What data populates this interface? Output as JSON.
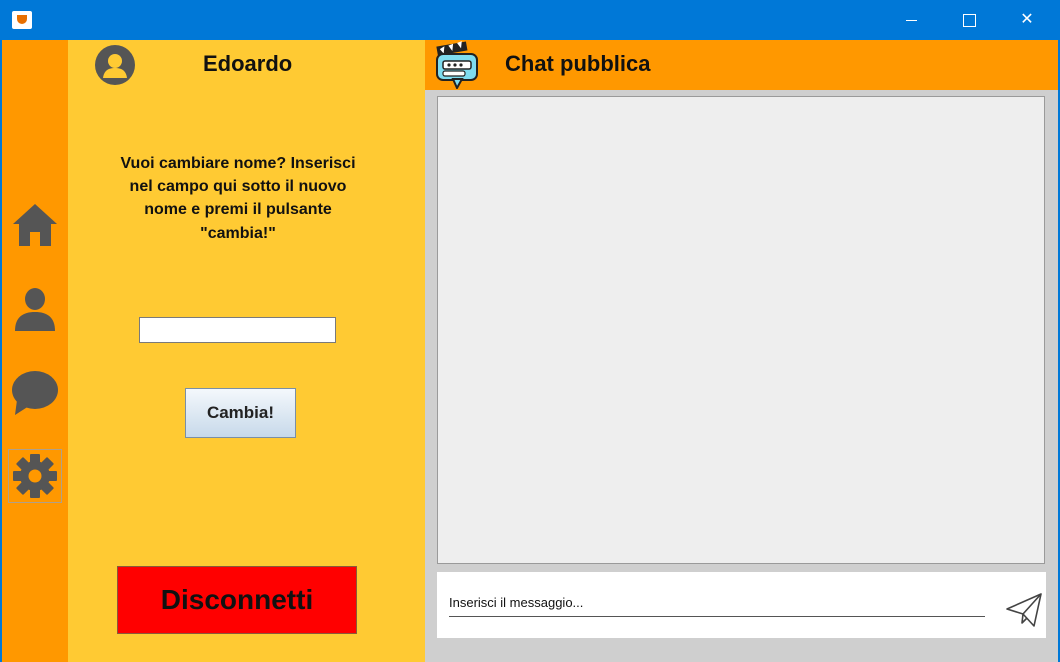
{
  "window": {
    "title": "",
    "buttons": [
      "minimize",
      "maximize",
      "close"
    ],
    "close_symbol": "✕"
  },
  "nav": {
    "items": [
      {
        "icon": "home-icon"
      },
      {
        "icon": "user-icon"
      },
      {
        "icon": "chat-bubble-icon"
      },
      {
        "icon": "gear-icon",
        "active": true
      }
    ]
  },
  "profile": {
    "username": "Edoardo",
    "instructions": "Vuoi cambiare nome? Inserisci nel campo qui sotto il nuovo nome e premi il pulsante \"cambia!\"",
    "name_input_value": "",
    "change_button_label": "Cambia!",
    "disconnect_button_label": "Disconnetti"
  },
  "chat": {
    "title": "Chat pubblica",
    "message_placeholder": "Inserisci il messaggio...",
    "message_value": ""
  },
  "colors": {
    "titlebar": "#0078d7",
    "nav_bg": "#ff9800",
    "panel_bg": "#ffca33",
    "chat_header_bg": "#ff9800",
    "messages_bg": "#eeeeee",
    "disconnect_bg": "#ff0000",
    "icon_gray": "#555555"
  }
}
